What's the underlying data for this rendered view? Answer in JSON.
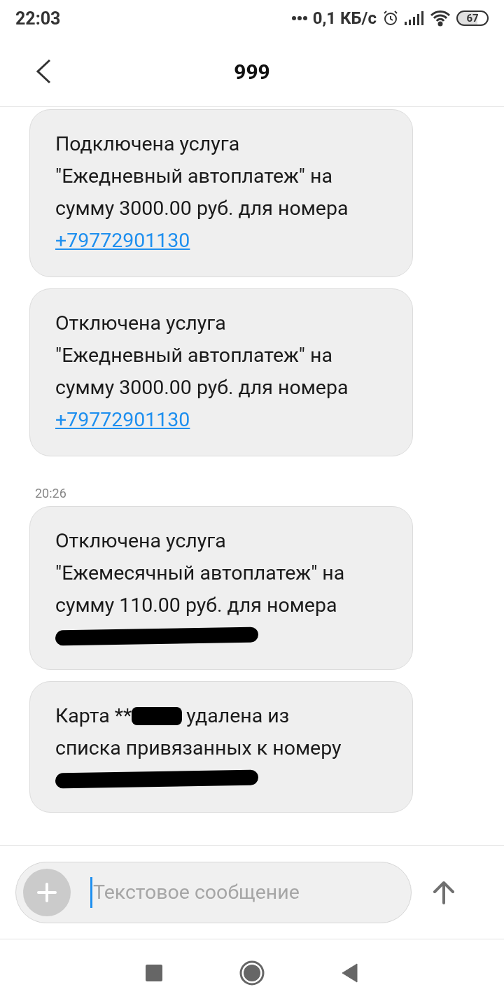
{
  "status_bar": {
    "time": "22:03",
    "speed": "0,1 КБ/с",
    "battery": "67"
  },
  "header": {
    "title": "999"
  },
  "messages": [
    {
      "kind": "message",
      "parts": [
        {
          "kind": "line",
          "text": "Подключена услуга\n\"Ежедневный автоплатеж\" на\nсумму 3000.00 руб. для номера"
        },
        {
          "kind": "link",
          "text": "+79772901130"
        }
      ]
    },
    {
      "kind": "message",
      "parts": [
        {
          "kind": "line",
          "text": "Отключена услуга\n\"Ежедневный автоплатеж\" на\nсумму 3000.00 руб. для номера"
        },
        {
          "kind": "link",
          "text": "+79772901130"
        }
      ]
    },
    {
      "kind": "time",
      "text": "20:26"
    },
    {
      "kind": "message",
      "parts": [
        {
          "kind": "line",
          "text": "Отключена услуга\n\"Ежемесячный автоплатеж\" на\nсумму 110.00 руб. для номера"
        },
        {
          "kind": "redaction_line"
        }
      ]
    },
    {
      "kind": "message",
      "parts": [
        {
          "kind": "text",
          "text": "Карта **"
        },
        {
          "kind": "redaction_inline"
        },
        {
          "kind": "text",
          "text": "удалена из"
        },
        {
          "kind": "line",
          "text": "списка привязанных к номеру"
        },
        {
          "kind": "redaction_line"
        }
      ]
    }
  ],
  "composer": {
    "placeholder": "Текстовое сообщение"
  }
}
